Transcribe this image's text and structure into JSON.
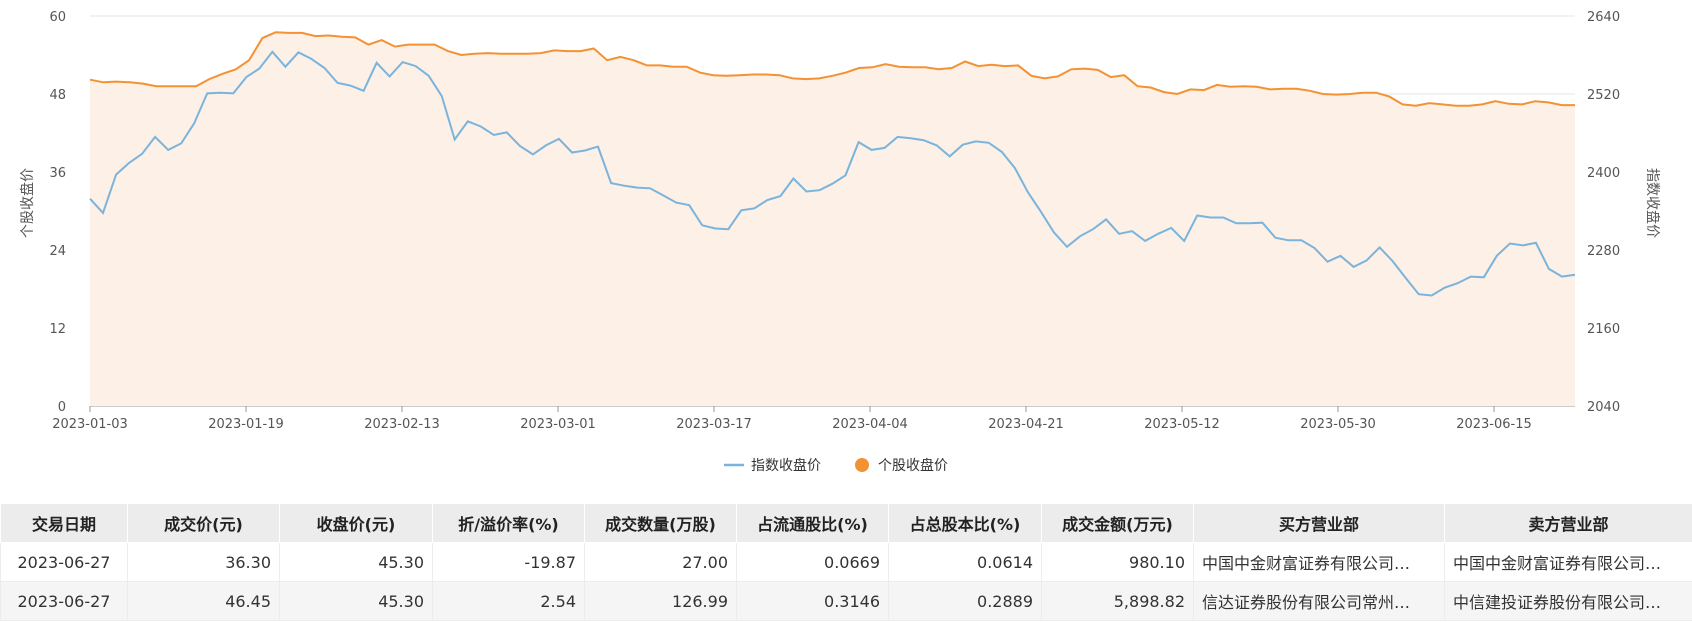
{
  "chart_data": {
    "type": "line",
    "y_left_label": "个股收盘价",
    "y_right_label": "指数收盘价",
    "y_left_range": [
      0,
      60
    ],
    "y_left_ticks": [
      "0",
      "12",
      "24",
      "36",
      "48",
      "60"
    ],
    "y_right_range": [
      2040,
      2640
    ],
    "y_right_ticks": [
      "2040",
      "2160",
      "2280",
      "2400",
      "2520",
      "2640"
    ],
    "x_ticks": [
      "2023-01-03",
      "2023-01-19",
      "2023-02-13",
      "2023-03-01",
      "2023-03-17",
      "2023-04-04",
      "2023-04-21",
      "2023-05-12",
      "2023-05-30",
      "2023-06-15"
    ],
    "grid": "horizontal",
    "legend_position": "bottom-center",
    "legend": {
      "index_label": "指数收盘价",
      "stock_label": "个股收盘价"
    },
    "colors": {
      "index": "#7ab4dd",
      "stock": "#f39233",
      "stock_area": "#fdf0e6"
    },
    "series": [
      {
        "name": "指数收盘价",
        "axis": "right",
        "values": [
          2359,
          2337,
          2396,
          2414,
          2428,
          2454,
          2434,
          2444,
          2475,
          2521,
          2522,
          2521,
          2546,
          2559,
          2585,
          2562,
          2584,
          2574,
          2560,
          2537,
          2533,
          2525,
          2568,
          2547,
          2569,
          2563,
          2548,
          2517,
          2450,
          2478,
          2470,
          2457,
          2461,
          2440,
          2427,
          2441,
          2451,
          2430,
          2433,
          2439,
          2383,
          2379,
          2376,
          2375,
          2364,
          2353,
          2349,
          2318,
          2313,
          2312,
          2341,
          2344,
          2357,
          2363,
          2390,
          2370,
          2372,
          2382,
          2395,
          2446,
          2434,
          2437,
          2454,
          2452,
          2449,
          2441,
          2424,
          2442,
          2447,
          2445,
          2431,
          2406,
          2369,
          2339,
          2307,
          2285,
          2301,
          2312,
          2327,
          2305,
          2309,
          2294,
          2305,
          2314,
          2294,
          2333,
          2330,
          2330,
          2321,
          2321,
          2322,
          2299,
          2295,
          2295,
          2283,
          2262,
          2271,
          2254,
          2264,
          2284,
          2263,
          2237,
          2212,
          2210,
          2222,
          2229,
          2239,
          2238,
          2271,
          2290,
          2287,
          2291,
          2251,
          2239,
          2242
        ]
      },
      {
        "name": "个股收盘价",
        "axis": "left",
        "values": [
          50.2,
          49.8,
          49.9,
          49.8,
          49.6,
          49.2,
          49.2,
          49.2,
          49.2,
          50.3,
          51.1,
          51.8,
          53.2,
          56.6,
          57.5,
          57.4,
          57.4,
          56.9,
          57.0,
          56.8,
          56.7,
          55.6,
          56.3,
          55.3,
          55.6,
          55.6,
          55.6,
          54.6,
          54.0,
          54.2,
          54.3,
          54.2,
          54.2,
          54.2,
          54.3,
          54.7,
          54.6,
          54.6,
          55.0,
          53.2,
          53.7,
          53.2,
          52.4,
          52.4,
          52.2,
          52.2,
          51.3,
          50.9,
          50.8,
          50.9,
          51.0,
          51.0,
          50.9,
          50.4,
          50.3,
          50.4,
          50.8,
          51.3,
          52.0,
          52.1,
          52.6,
          52.2,
          52.1,
          52.1,
          51.8,
          52.0,
          53.0,
          52.3,
          52.5,
          52.3,
          52.4,
          50.8,
          50.4,
          50.7,
          51.8,
          51.9,
          51.7,
          50.6,
          50.9,
          49.2,
          49.0,
          48.3,
          48.0,
          48.7,
          48.6,
          49.4,
          49.1,
          49.2,
          49.1,
          48.7,
          48.8,
          48.8,
          48.5,
          48.0,
          47.9,
          48.0,
          48.2,
          48.2,
          47.6,
          46.4,
          46.2,
          46.6,
          46.4,
          46.2,
          46.2,
          46.4,
          46.9,
          46.5,
          46.4,
          46.9,
          46.7,
          46.3,
          46.3
        ]
      }
    ]
  },
  "table": {
    "headers": [
      "交易日期",
      "成交价(元)",
      "收盘价(元)",
      "折/溢价率(%)",
      "成交数量(万股)",
      "占流通股比(%)",
      "占总股本比(%)",
      "成交金额(万元)",
      "买方营业部",
      "卖方营业部"
    ],
    "rows": [
      [
        "2023-06-27",
        "36.30",
        "45.30",
        "-19.87",
        "27.00",
        "0.0669",
        "0.0614",
        "980.10",
        "中国中金财富证券有限公司…",
        "中国中金财富证券有限公司…"
      ],
      [
        "2023-06-27",
        "46.45",
        "45.30",
        "2.54",
        "126.99",
        "0.3146",
        "0.2889",
        "5,898.82",
        "信达证券股份有限公司常州…",
        "中信建投证券股份有限公司…"
      ]
    ]
  }
}
